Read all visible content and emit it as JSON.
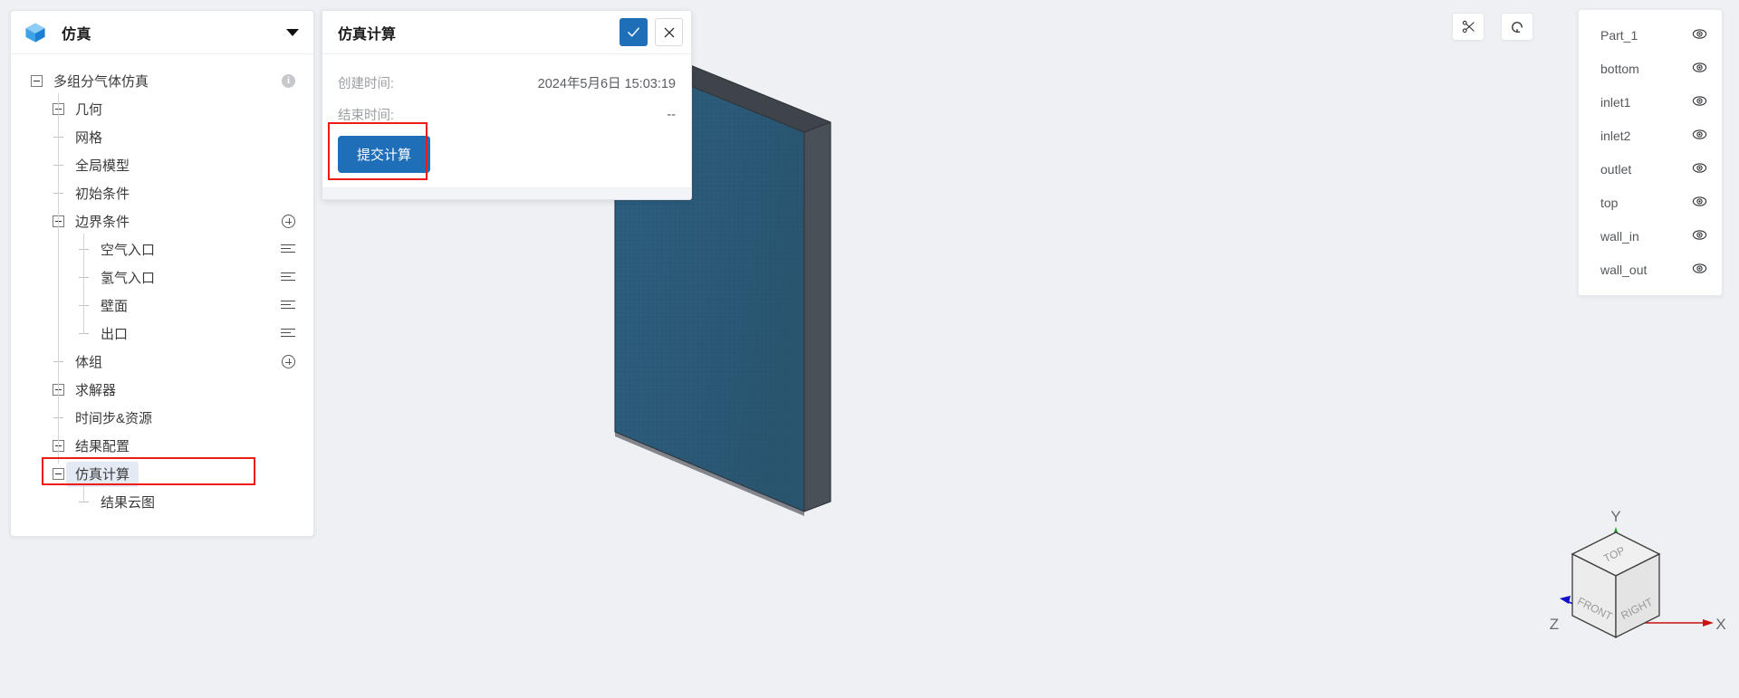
{
  "sidebar": {
    "app_title": "仿真",
    "logo_icon": "cube-logo-icon",
    "caret_icon": "chevron-down-icon",
    "tree": [
      {
        "label": "多组分气体仿真",
        "toggle": "minus",
        "depth": 0,
        "action": "info"
      },
      {
        "label": "几何",
        "toggle": "plus",
        "depth": 1,
        "action": "none"
      },
      {
        "label": "网格",
        "toggle": "stub",
        "depth": 1,
        "action": "none"
      },
      {
        "label": "全局模型",
        "toggle": "stub",
        "depth": 1,
        "action": "none"
      },
      {
        "label": "初始条件",
        "toggle": "stub",
        "depth": 1,
        "action": "none"
      },
      {
        "label": "边界条件",
        "toggle": "minus",
        "depth": 1,
        "action": "plus-circle"
      },
      {
        "label": "空气入口",
        "toggle": "stub",
        "depth": 2,
        "action": "list"
      },
      {
        "label": "氢气入口",
        "toggle": "stub",
        "depth": 2,
        "action": "list"
      },
      {
        "label": "壁面",
        "toggle": "stub",
        "depth": 2,
        "action": "list"
      },
      {
        "label": "出口",
        "toggle": "stub",
        "depth": 2,
        "action": "list"
      },
      {
        "label": "体组",
        "toggle": "stub",
        "depth": 1,
        "action": "plus-circle"
      },
      {
        "label": "求解器",
        "toggle": "plus",
        "depth": 1,
        "action": "none"
      },
      {
        "label": "时间步&资源",
        "toggle": "stub",
        "depth": 1,
        "action": "none"
      },
      {
        "label": "结果配置",
        "toggle": "plus",
        "depth": 1,
        "action": "none"
      },
      {
        "label": "仿真计算",
        "toggle": "minus",
        "depth": 1,
        "action": "none",
        "selected": true
      },
      {
        "label": "结果云图",
        "toggle": "stub",
        "depth": 2,
        "action": "none"
      }
    ]
  },
  "dialog": {
    "title": "仿真计算",
    "confirm_icon": "check-icon",
    "cancel_icon": "close-icon",
    "created_label": "创建时间:",
    "created_value": "2024年5月6日 15:03:19",
    "finished_label": "结束时间:",
    "finished_value": "--",
    "submit_label": "提交计算"
  },
  "toolbar": {
    "buttons": [
      {
        "name": "scissors-icon",
        "title": "clip"
      },
      {
        "name": "rotate-icon",
        "title": "reset-view"
      }
    ]
  },
  "parts_panel": {
    "eye_icon": "eye-icon",
    "items": [
      {
        "name": "Part_1"
      },
      {
        "name": "bottom"
      },
      {
        "name": "inlet1"
      },
      {
        "name": "inlet2"
      },
      {
        "name": "outlet"
      },
      {
        "name": "top"
      },
      {
        "name": "wall_in"
      },
      {
        "name": "wall_out"
      }
    ]
  },
  "nav_cube": {
    "faces": {
      "top": "TOP",
      "front": "FRONT",
      "right": "RIGHT"
    },
    "axes": {
      "x": "X",
      "y": "Y",
      "z": "Z"
    },
    "axis_colors": {
      "x": "#cc1111",
      "y": "#11aa22",
      "z": "#1111cc"
    }
  },
  "viewport": {
    "background": "#eef0f4",
    "model_face_color": "#2c5a75",
    "model_side_color": "#444a50",
    "model_top_color": "#3e444a"
  },
  "annotations": {
    "highlight_color": "#ee1c16"
  }
}
